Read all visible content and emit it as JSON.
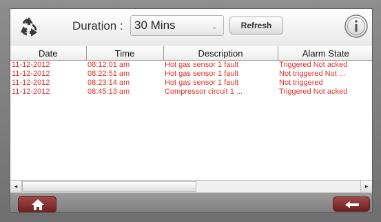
{
  "toolbar": {
    "duration_label": "Duration :",
    "duration_value": "30 Mins",
    "refresh_label": "Refresh"
  },
  "table": {
    "headers": [
      "Date",
      "Time",
      "Description",
      "Alarm State"
    ],
    "rows": [
      [
        "11-12-2012",
        "08:12:01 am",
        "Hot gas sensor 1 fault",
        "Triggered Not acked"
      ],
      [
        "11-12-2012",
        "08:22:51 am",
        "Hot gas sensor 1 fault",
        "Not triggered Not ..."
      ],
      [
        "11-12-2012",
        "08:23:14 am",
        "Hot gas sensor 1 fault",
        "Not triggered"
      ],
      [
        "11-12-2012",
        "08:45:13 am",
        "Compressor circuit 1 ...",
        "Triggered Not acked"
      ]
    ]
  },
  "icons": {
    "recycle": "recycle-icon",
    "info": "info-icon",
    "home": "home-icon",
    "back": "back-arrow-icon",
    "scroll_left": "◂",
    "scroll_right": "▸",
    "select_arrow": "⌄"
  },
  "colors": {
    "alarm_text": "#e0302a",
    "button_maroon": "#8a2f2f"
  }
}
